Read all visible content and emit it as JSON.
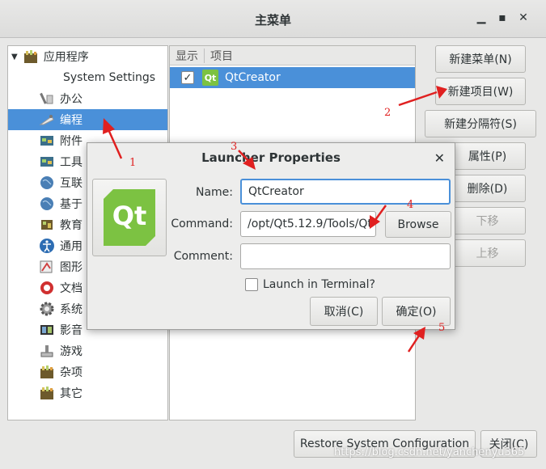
{
  "window": {
    "title": "主菜单"
  },
  "tree": {
    "items": [
      {
        "label": "应用程序",
        "icon": "folder-icon"
      },
      {
        "label": "System Settings",
        "icon": ""
      },
      {
        "label": "办公",
        "icon": "office-icon"
      },
      {
        "label": "编程",
        "icon": "programming-icon"
      },
      {
        "label": "附件",
        "icon": "accessories-icon"
      },
      {
        "label": "工具",
        "icon": "tools-icon"
      },
      {
        "label": "互联",
        "icon": "internet-icon"
      },
      {
        "label": "基于",
        "icon": "globe-icon"
      },
      {
        "label": "教育",
        "icon": "education-icon"
      },
      {
        "label": "通用",
        "icon": "accessibility-icon"
      },
      {
        "label": "图形",
        "icon": "graphics-icon"
      },
      {
        "label": "文档",
        "icon": "help-icon"
      },
      {
        "label": "系统",
        "icon": "system-gear-icon"
      },
      {
        "label": "影音",
        "icon": "multimedia-icon"
      },
      {
        "label": "游戏",
        "icon": "games-icon"
      },
      {
        "label": "杂项",
        "icon": "misc-icon"
      },
      {
        "label": "其它",
        "icon": "other-icon"
      }
    ]
  },
  "items_panel": {
    "col_show": "显示",
    "col_item": "项目",
    "rows": [
      {
        "checked": true,
        "name": "QtCreator",
        "icon_text": "Qt"
      }
    ]
  },
  "buttons": {
    "new_menu": "新建菜单(N)",
    "new_item": "新建项目(W)",
    "new_separator": "新建分隔符(S)",
    "properties": "属性(P)",
    "delete": "删除(D)",
    "move_down": "下移",
    "move_up": "上移",
    "restore": "Restore System Configuration",
    "close": "关闭(C)"
  },
  "dialog": {
    "title": "Launcher Properties",
    "icon_text": "Qt",
    "name_label": "Name:",
    "name_value": "QtCreator",
    "command_label": "Command:",
    "command_value": "/opt/Qt5.12.9/Tools/Qt",
    "browse": "Browse",
    "comment_label": "Comment:",
    "comment_value": "",
    "launch_terminal": "Launch in Terminal?",
    "cancel": "取消(C)",
    "ok": "确定(O)"
  },
  "annotations": [
    "1",
    "2",
    "3",
    "4",
    "5"
  ],
  "watermark": "https://blog.csdn.net/yanchenyu365",
  "colors": {
    "selection": "#4a90d9",
    "annotation": "#e02020",
    "qt_green": "#7cc242"
  }
}
